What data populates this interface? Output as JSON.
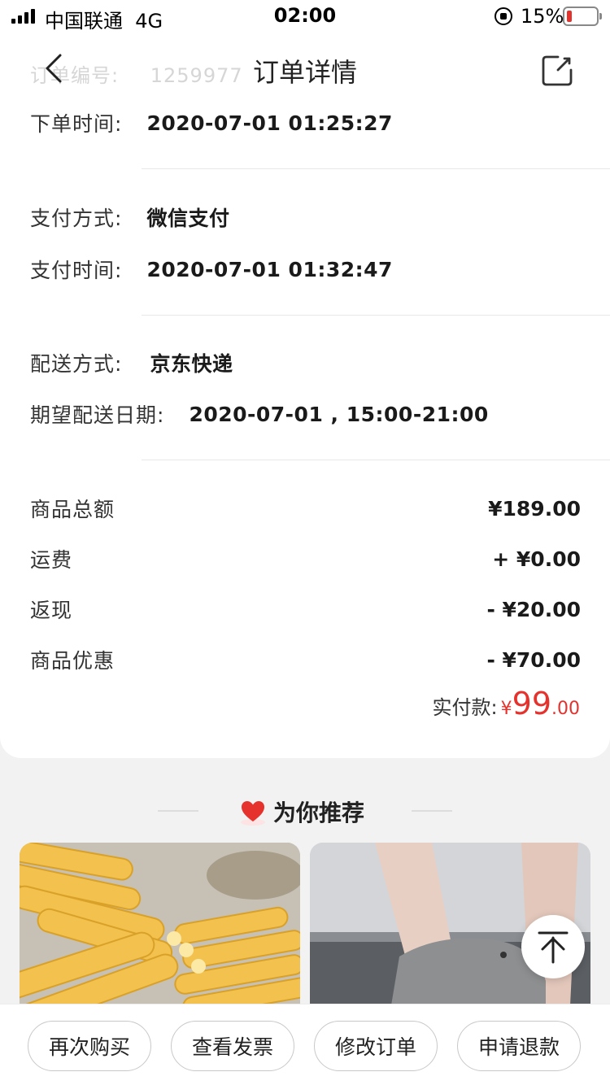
{
  "status_bar": {
    "carrier": "中国联通",
    "network": "4G",
    "time": "02:00",
    "battery": "15%"
  },
  "nav": {
    "title": "订单详情",
    "ghost_label": "订单编号:",
    "ghost_value": "1259977"
  },
  "order": {
    "order_time_label": "下单时间:",
    "order_time": "2020-07-01 01:25:27",
    "pay_method_label": "支付方式:",
    "pay_method": "微信支付",
    "pay_time_label": "支付时间:",
    "pay_time": "2020-07-01 01:32:47",
    "delivery_label": "配送方式:",
    "delivery": "京东快递",
    "expect_label": "期望配送日期:",
    "expect_date": "2020-07-01 , 15:00-21:00"
  },
  "amounts": [
    {
      "label": "商品总额",
      "value": "¥189.00"
    },
    {
      "label": "运费",
      "value": "+ ¥0.00"
    },
    {
      "label": "返现",
      "value": "- ¥20.00"
    },
    {
      "label": "商品优惠",
      "value": "- ¥70.00"
    }
  ],
  "total": {
    "label": "实付款:",
    "currency": "¥",
    "integer": "99",
    "decimal": ".00"
  },
  "recommend": {
    "title": "为你推荐"
  },
  "buttons": {
    "buy_again": "再次购买",
    "view_invoice": "查看发票",
    "modify_order": "修改订单",
    "refund": "申请退款"
  },
  "colors": {
    "accent": "#e5322d"
  }
}
